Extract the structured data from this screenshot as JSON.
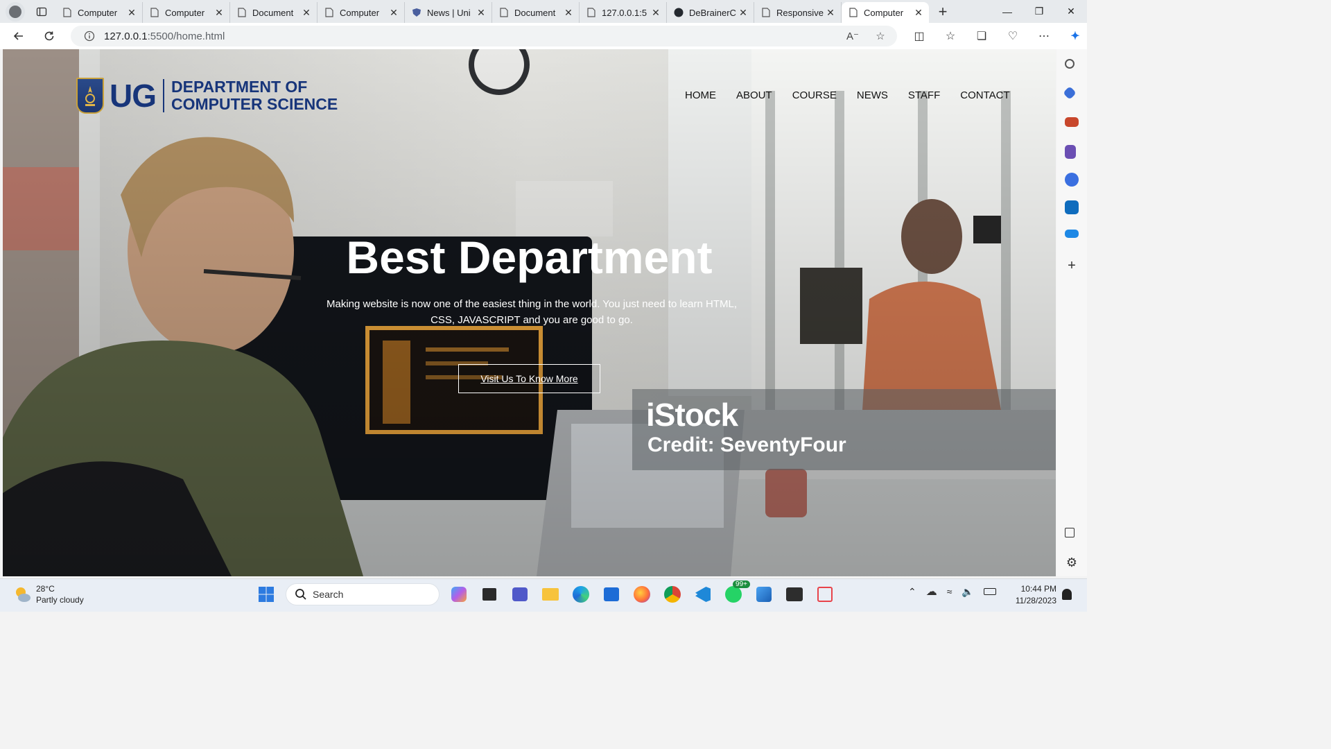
{
  "browser": {
    "tabs": [
      {
        "title": "Computer",
        "icon": "page-icon"
      },
      {
        "title": "Computer",
        "icon": "page-icon"
      },
      {
        "title": "Document",
        "icon": "page-icon"
      },
      {
        "title": "Computer",
        "icon": "page-icon"
      },
      {
        "title": "News | Uni",
        "icon": "shield-icon"
      },
      {
        "title": "Document",
        "icon": "page-icon"
      },
      {
        "title": "127.0.0.1:5",
        "icon": "page-icon"
      },
      {
        "title": "DeBrainerC",
        "icon": "github-icon"
      },
      {
        "title": "Responsive",
        "icon": "page-icon"
      },
      {
        "title": "Computer",
        "icon": "page-icon"
      }
    ],
    "active_tab_index": 9,
    "url_host": "127.0.0.1",
    "url_rest": ":5500/home.html",
    "accent": "#1a73e8"
  },
  "page": {
    "logo_ug": "UG",
    "logo_dept_line1": "DEPARTMENT OF",
    "logo_dept_line2": "COMPUTER SCIENCE",
    "brand_color": "#17357a",
    "nav": [
      "HOME",
      "ABOUT",
      "COURSE",
      "NEWS",
      "STAFF",
      "CONTACT"
    ],
    "headline": "Best Department",
    "subtext": "Making website is now one of the easiest thing in the world. You just need to learn HTML, CSS, JAVASCRIPT and you are good to go.",
    "cta": "Visit Us To Know More",
    "watermark_brand": "iStock",
    "watermark_credit": "Credit: SeventyFour"
  },
  "taskbar": {
    "temperature": "28°C",
    "condition": "Partly cloudy",
    "search_label": "Search",
    "whatsapp_badge": "99+",
    "time": "10:44 PM",
    "date": "11/28/2023"
  }
}
